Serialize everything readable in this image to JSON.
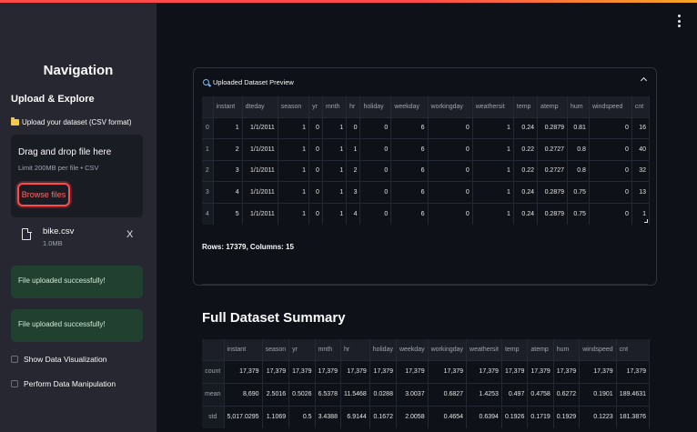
{
  "sidebar": {
    "nav_title": "Navigation",
    "section_heading": "Upload & Explore",
    "upload_label": "Upload your dataset (CSV format)",
    "dropzone": {
      "title": "Drag and drop file here",
      "subtitle": "Limit 200MB per file • CSV",
      "browse_label": "Browse files"
    },
    "file": {
      "name": "bike.csv",
      "size": "1.0MB",
      "remove_label": "X"
    },
    "alerts": [
      "File uploaded successfully!",
      "File uploaded successfully!"
    ],
    "checkboxes": [
      "Show Data Visualization",
      "Perform Data Manipulation"
    ]
  },
  "main": {
    "expander_title": "Uploaded Dataset Preview",
    "preview_table": {
      "columns": [
        "",
        "instant",
        "dteday",
        "season",
        "yr",
        "mnth",
        "hr",
        "holiday",
        "weekday",
        "workingday",
        "weathersit",
        "temp",
        "atemp",
        "hum",
        "windspeed",
        "cnt"
      ],
      "rows": [
        [
          "0",
          "1",
          "1/1/2011",
          "1",
          "0",
          "1",
          "0",
          "0",
          "6",
          "0",
          "1",
          "0.24",
          "0.2879",
          "0.81",
          "0",
          "16"
        ],
        [
          "1",
          "2",
          "1/1/2011",
          "1",
          "0",
          "1",
          "1",
          "0",
          "6",
          "0",
          "1",
          "0.22",
          "0.2727",
          "0.8",
          "0",
          "40"
        ],
        [
          "2",
          "3",
          "1/1/2011",
          "1",
          "0",
          "1",
          "2",
          "0",
          "6",
          "0",
          "1",
          "0.22",
          "0.2727",
          "0.8",
          "0",
          "32"
        ],
        [
          "3",
          "4",
          "1/1/2011",
          "1",
          "0",
          "1",
          "3",
          "0",
          "6",
          "0",
          "1",
          "0.24",
          "0.2879",
          "0.75",
          "0",
          "13"
        ],
        [
          "4",
          "5",
          "1/1/2011",
          "1",
          "0",
          "1",
          "4",
          "0",
          "6",
          "0",
          "1",
          "0.24",
          "0.2879",
          "0.75",
          "0",
          "1"
        ]
      ]
    },
    "rows_info": "Rows: 17379, Columns: 15",
    "summary_title": "Full Dataset Summary",
    "summary_table": {
      "columns": [
        "",
        "instant",
        "season",
        "yr",
        "mnth",
        "hr",
        "holiday",
        "weekday",
        "workingday",
        "weathersit",
        "temp",
        "atemp",
        "hum",
        "windspeed",
        "cnt"
      ],
      "rows": [
        [
          "count",
          "17,379",
          "17,379",
          "17,379",
          "17,379",
          "17,379",
          "17,379",
          "17,379",
          "17,379",
          "17,379",
          "17,379",
          "17,379",
          "17,379",
          "17,379",
          "17,379"
        ],
        [
          "mean",
          "8,690",
          "2.5016",
          "0.5026",
          "6.5378",
          "11.5468",
          "0.0288",
          "3.0037",
          "0.6827",
          "1.4253",
          "0.497",
          "0.4758",
          "0.6272",
          "0.1901",
          "189.4631"
        ],
        [
          "std",
          "5,017.0295",
          "1.1069",
          "0.5",
          "3.4388",
          "6.9144",
          "0.1672",
          "2.0058",
          "0.4654",
          "0.6394",
          "0.1926",
          "0.1719",
          "0.1929",
          "0.1223",
          "181.3876"
        ]
      ]
    }
  }
}
